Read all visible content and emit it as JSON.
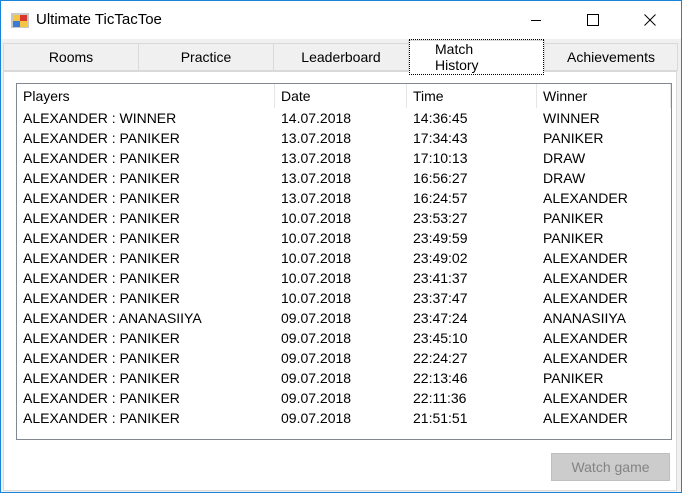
{
  "window": {
    "title": "Ultimate TicTacToe",
    "accent_color": "#1883d7"
  },
  "tabs": [
    {
      "label": "Rooms"
    },
    {
      "label": "Practice"
    },
    {
      "label": "Leaderboard"
    },
    {
      "label": "Match History",
      "selected": true
    },
    {
      "label": "Achievements"
    }
  ],
  "match_history": {
    "columns": [
      "Players",
      "Date",
      "Time",
      "Winner"
    ],
    "rows": [
      [
        "ALEXANDER : WINNER",
        "14.07.2018",
        "14:36:45",
        "WINNER"
      ],
      [
        "ALEXANDER : PANIKER",
        "13.07.2018",
        "17:34:43",
        "PANIKER"
      ],
      [
        "ALEXANDER : PANIKER",
        "13.07.2018",
        "17:10:13",
        "DRAW"
      ],
      [
        "ALEXANDER : PANIKER",
        "13.07.2018",
        "16:56:27",
        "DRAW"
      ],
      [
        "ALEXANDER : PANIKER",
        "13.07.2018",
        "16:24:57",
        "ALEXANDER"
      ],
      [
        "ALEXANDER : PANIKER",
        "10.07.2018",
        "23:53:27",
        "PANIKER"
      ],
      [
        "ALEXANDER : PANIKER",
        "10.07.2018",
        "23:49:59",
        "PANIKER"
      ],
      [
        "ALEXANDER : PANIKER",
        "10.07.2018",
        "23:49:02",
        "ALEXANDER"
      ],
      [
        "ALEXANDER : PANIKER",
        "10.07.2018",
        "23:41:37",
        "ALEXANDER"
      ],
      [
        "ALEXANDER : PANIKER",
        "10.07.2018",
        "23:37:47",
        "ALEXANDER"
      ],
      [
        "ALEXANDER : ANANASIIYA",
        "09.07.2018",
        "23:47:24",
        "ANANASIIYA"
      ],
      [
        "ALEXANDER : PANIKER",
        "09.07.2018",
        "23:45:10",
        "ALEXANDER"
      ],
      [
        "ALEXANDER : PANIKER",
        "09.07.2018",
        "22:24:27",
        "ALEXANDER"
      ],
      [
        "ALEXANDER : PANIKER",
        "09.07.2018",
        "22:13:46",
        "PANIKER"
      ],
      [
        "ALEXANDER : PANIKER",
        "09.07.2018",
        "22:11:36",
        "ALEXANDER"
      ],
      [
        "ALEXANDER : PANIKER",
        "09.07.2018",
        "21:51:51",
        "ALEXANDER"
      ]
    ]
  },
  "buttons": {
    "watch_game": {
      "label": "Watch game",
      "enabled": false
    }
  },
  "icons": {
    "app": "app-icon",
    "minimize": "minimize-icon",
    "maximize": "maximize-icon",
    "close": "close-icon"
  }
}
